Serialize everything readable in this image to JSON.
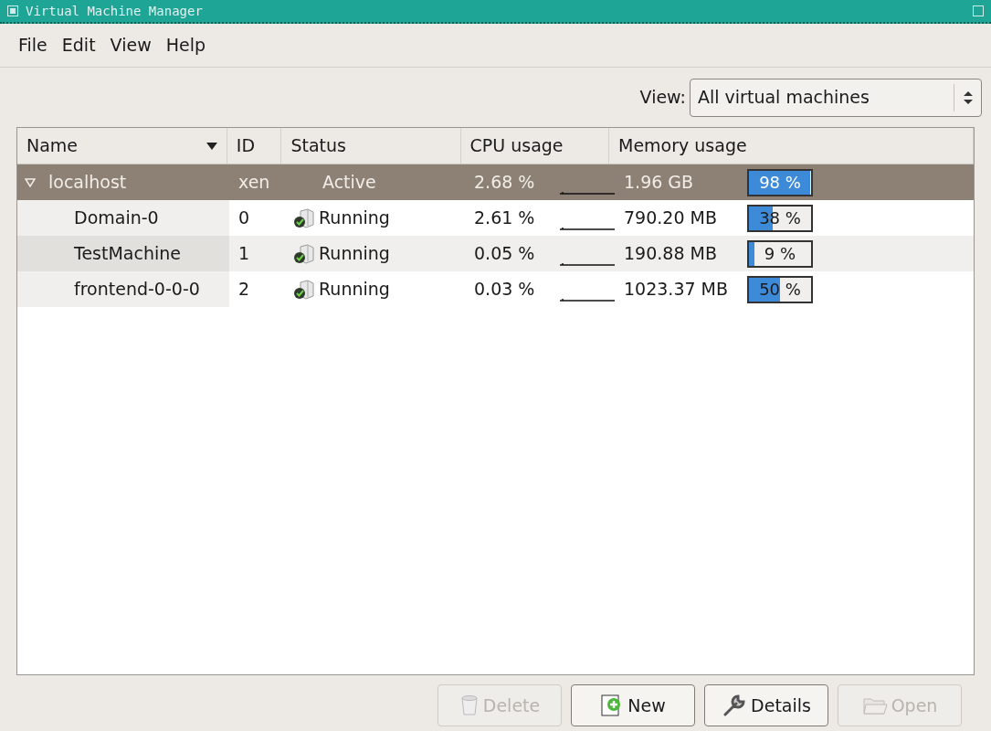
{
  "window": {
    "title": "Virtual Machine Manager"
  },
  "menu": [
    "File",
    "Edit",
    "View",
    "Help"
  ],
  "view_filter": {
    "label": "View:",
    "value": "All virtual machines"
  },
  "table": {
    "columns": [
      {
        "label": "Name",
        "sorted": true
      },
      {
        "label": "ID",
        "sorted": false
      },
      {
        "label": "Status",
        "sorted": false
      },
      {
        "label": "CPU usage",
        "sorted": false
      },
      {
        "label": "Memory usage",
        "sorted": false
      }
    ],
    "rows": [
      {
        "name": "localhost",
        "id": "xen",
        "status": "Active",
        "cpu": "2.68 %",
        "memory": "1.96 GB",
        "memory_percent": "98 %",
        "level": 0.98,
        "selected": true,
        "expanded": true,
        "children": [
          {
            "name": "Domain-0",
            "id": "0",
            "status": "Running",
            "cpu": "2.61 %",
            "memory": "790.20 MB",
            "memory_percent": "38 %",
            "level": 0.38,
            "selected": false
          },
          {
            "name": "TestMachine",
            "id": "1",
            "status": "Running",
            "cpu": "0.05 %",
            "memory": "190.88 MB",
            "memory_percent": "9 %",
            "level": 0.09,
            "selected": false
          },
          {
            "name": "frontend-0-0-0",
            "id": "2",
            "status": "Running",
            "cpu": "0.03 %",
            "memory": "1023.37 MB",
            "memory_percent": "50 %",
            "level": 0.5,
            "selected": false
          }
        ]
      }
    ]
  },
  "buttons": [
    {
      "label": "Delete",
      "kind": "delete",
      "disabled": true
    },
    {
      "label": "New",
      "kind": "new",
      "disabled": false
    },
    {
      "label": "Details",
      "kind": "details",
      "disabled": false
    },
    {
      "label": "Open",
      "kind": "open",
      "disabled": true
    }
  ]
}
